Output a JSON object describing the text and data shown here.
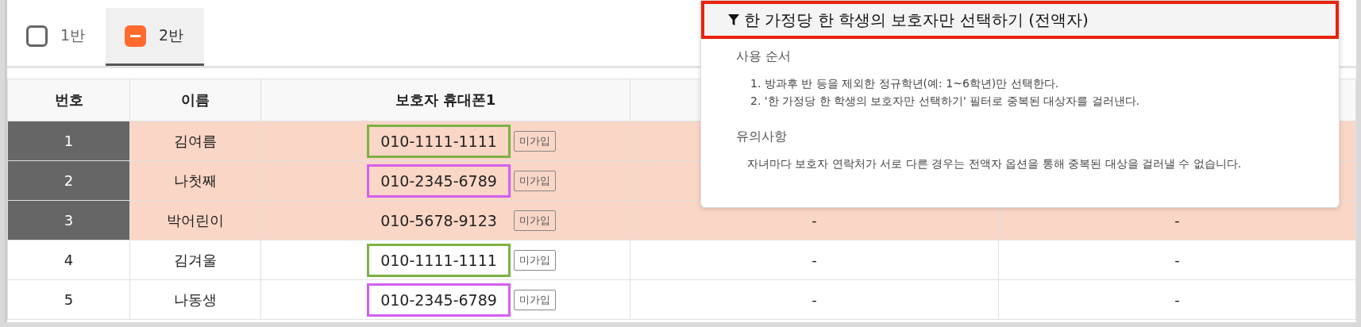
{
  "tabs": [
    {
      "label": "1반",
      "checked": false,
      "indeterminate": false,
      "selected": false
    },
    {
      "label": "2반",
      "checked": true,
      "indeterminate": true,
      "selected": true
    }
  ],
  "table": {
    "columns": [
      "번호",
      "이름",
      "보호자 휴대폰1"
    ],
    "rows": [
      {
        "number": "1",
        "name": "김여름",
        "phone": "010-1111-1111",
        "color": "#7cb342",
        "badge": "미가입",
        "selected": true
      },
      {
        "number": "2",
        "name": "나첫째",
        "phone": "010-2345-6789",
        "color": "#d45ef0",
        "badge": "미가입",
        "selected": true
      },
      {
        "number": "3",
        "name": "박어린이",
        "phone": "010-5678-9123",
        "badge": "미가입",
        "selected": true,
        "column_4": "-",
        "column_5": "-"
      },
      {
        "number": "4",
        "name": "김겨울",
        "phone": "010-1111-1111",
        "color": "#7cb342",
        "badge": "미가입",
        "selected": false,
        "column_4": "-",
        "column_5": "-"
      },
      {
        "number": "5",
        "name": "나동생",
        "phone": "010-2345-6789",
        "color": "#d45ef0",
        "badge": "미가입",
        "selected": false,
        "column_4": "-",
        "column_5": "-"
      }
    ]
  },
  "filter_popup": {
    "title": "한 가정당 한 학생의 보호자만 선택하기 (전액자)",
    "sections": [
      {
        "heading": "사용 순서",
        "kind": "ordered",
        "items": [
          "1. 방과후 반 등을 제외한 정규학년(예: 1~6학년)만 선택한다.",
          "2. '한 가정당 한 학생의 보호자만 선택하기' 필터로 중복된 대상자를 걸러낸다."
        ]
      },
      {
        "heading": "유의사항",
        "kind": "plain",
        "items": [
          "자녀마다 보호자 연락처가 서로 다른 경우는 전액자 옵션을 통해 중복된 대상을 걸러낼 수 없습니다."
        ]
      }
    ]
  }
}
